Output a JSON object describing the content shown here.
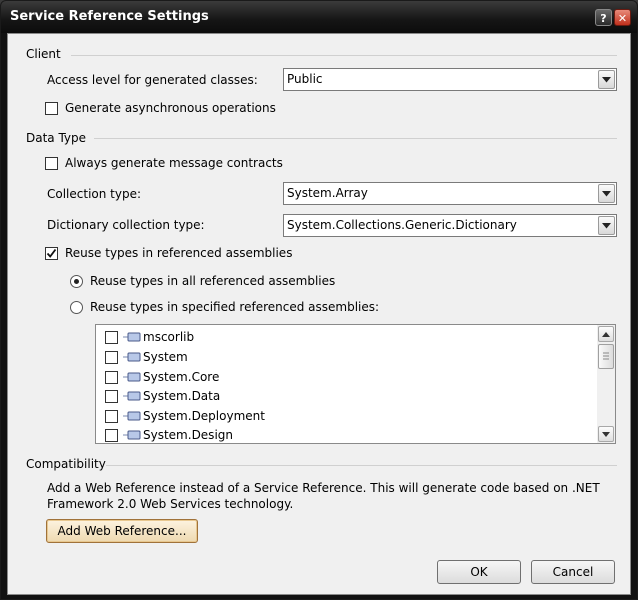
{
  "window": {
    "title": "Service Reference Settings"
  },
  "client_group": {
    "header": "Client",
    "access_level_label": "Access level for generated classes:",
    "access_level_value": "Public",
    "async_label": "Generate asynchronous operations",
    "async_checked": false
  },
  "data_type_group": {
    "header": "Data Type",
    "message_contracts_label": "Always generate message contracts",
    "message_contracts_checked": false,
    "collection_type_label": "Collection type:",
    "collection_type_value": "System.Array",
    "dictionary_type_label": "Dictionary collection type:",
    "dictionary_type_value": "System.Collections.Generic.Dictionary",
    "reuse_types_label": "Reuse types in referenced assemblies",
    "reuse_types_checked": true,
    "reuse_all_label": "Reuse types in all referenced assemblies",
    "reuse_specified_label": "Reuse types in specified referenced assemblies:",
    "selected_option": "all",
    "assemblies": [
      {
        "name": "mscorlib",
        "checked": false
      },
      {
        "name": "System",
        "checked": false
      },
      {
        "name": "System.Core",
        "checked": false
      },
      {
        "name": "System.Data",
        "checked": false
      },
      {
        "name": "System.Deployment",
        "checked": false
      },
      {
        "name": "System.Design",
        "checked": false
      }
    ]
  },
  "compatibility_group": {
    "header": "Compatibility",
    "description_line1": "Add a Web Reference instead of a Service Reference. This will generate code based on .NET",
    "description_line2": "Framework 2.0 Web Services technology.",
    "add_web_reference_label": "Add Web Reference..."
  },
  "buttons": {
    "ok_label": "OK",
    "cancel_label": "Cancel"
  }
}
